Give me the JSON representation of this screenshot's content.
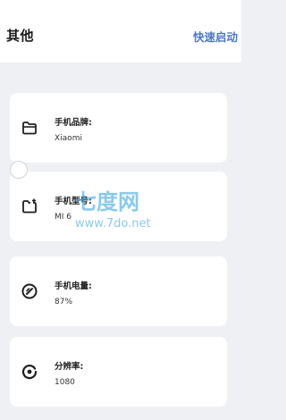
{
  "header": {
    "title": "其他",
    "quick_start": "快速启动"
  },
  "info": [
    {
      "label": "手机品牌:",
      "value": "Xiaomi",
      "icon": "folder-icon"
    },
    {
      "label": "手机型号:",
      "value": "MI 6",
      "icon": "folder-add-icon"
    },
    {
      "label": "手机电量:",
      "value": "87%",
      "icon": "battery-icon"
    },
    {
      "label": "分辨率:",
      "value": "1080",
      "icon": "resolution-icon"
    }
  ],
  "watermark": {
    "logo_text": "七度网",
    "url": "www.7do.net"
  },
  "colors": {
    "accent": "#4d78c7",
    "background": "#eef0f3",
    "card": "#ffffff"
  }
}
